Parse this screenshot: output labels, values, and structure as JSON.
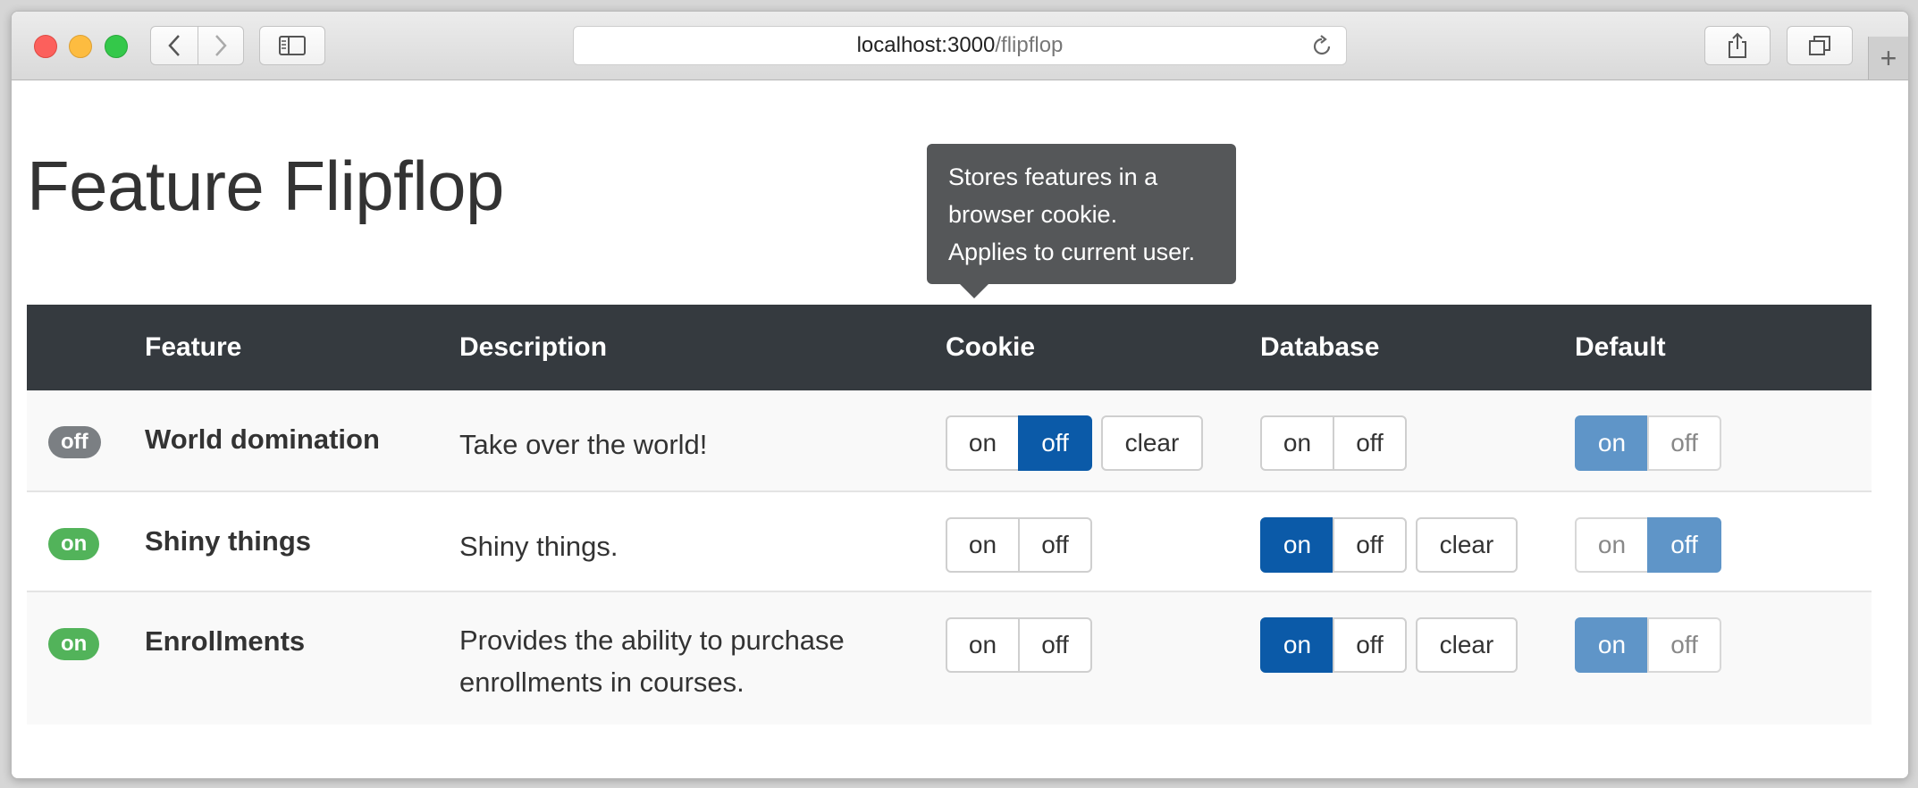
{
  "browser": {
    "url_host": "localhost:3000",
    "url_path": "/flipflop",
    "new_tab_label": "+"
  },
  "page": {
    "title": "Feature Flipflop"
  },
  "tooltip": {
    "lines": [
      "Stores features in a",
      "browser cookie.",
      "Applies to current user."
    ]
  },
  "table": {
    "headers": {
      "status": "",
      "feature": "Feature",
      "description": "Description",
      "cookie": "Cookie",
      "database": "Database",
      "default": "Default"
    },
    "rows": [
      {
        "status": "off",
        "feature": "World domination",
        "description": "Take over the world!",
        "cookie": {
          "on": "on",
          "off": "off",
          "clear": "clear",
          "selected": "off"
        },
        "database": {
          "on": "on",
          "off": "off",
          "selected": "none"
        },
        "default": {
          "on": "on",
          "off": "off",
          "selected": "on"
        }
      },
      {
        "status": "on",
        "feature": "Shiny things",
        "description": "Shiny things.",
        "cookie": {
          "on": "on",
          "off": "off",
          "selected": "none"
        },
        "database": {
          "on": "on",
          "off": "off",
          "clear": "clear",
          "selected": "on"
        },
        "default": {
          "on": "on",
          "off": "off",
          "selected": "off"
        }
      },
      {
        "status": "on",
        "feature": "Enrollments",
        "description_lines": [
          "Provides the ability to purchase",
          "enrollments in courses."
        ],
        "cookie": {
          "on": "on",
          "off": "off",
          "selected": "none"
        },
        "database": {
          "on": "on",
          "off": "off",
          "clear": "clear",
          "selected": "on"
        },
        "default": {
          "on": "on",
          "off": "off",
          "selected": "on"
        }
      }
    ]
  },
  "colors": {
    "header_bg": "#353a3f",
    "active_button": "#0b5aa8",
    "default_selected": "#5f95c8",
    "badge_on": "#52b35a",
    "badge_off": "#7b7f83",
    "tooltip_bg": "#555759"
  }
}
